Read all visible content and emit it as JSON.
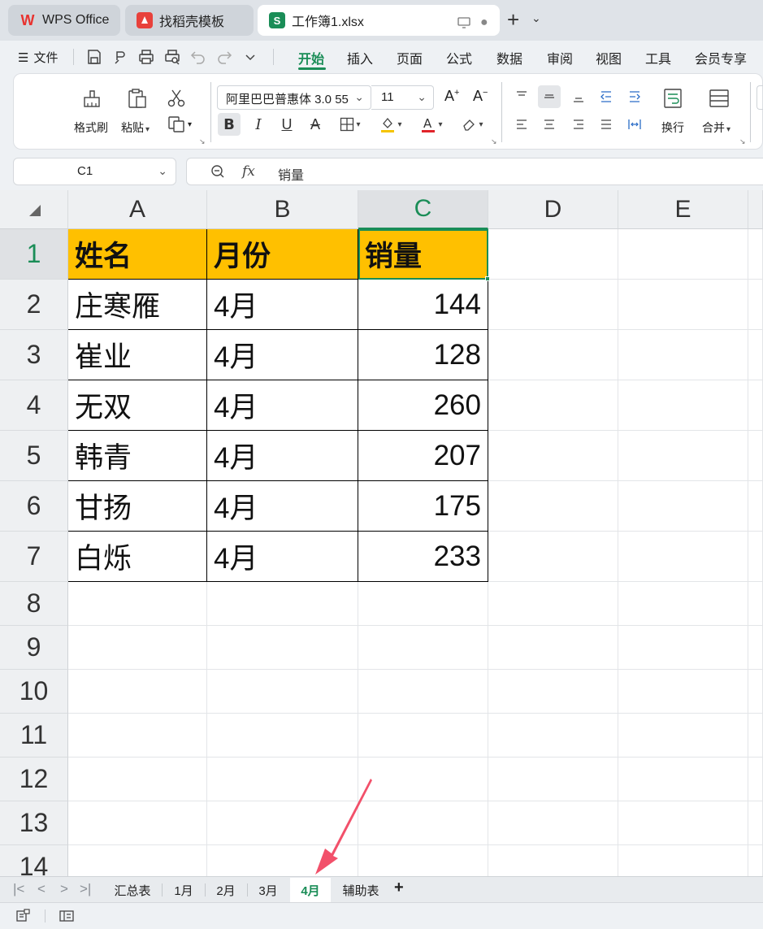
{
  "tabs": [
    {
      "label": "WPS Office",
      "icon": "wps-logo-icon"
    },
    {
      "label": "找稻壳模板",
      "icon": "docer-icon"
    },
    {
      "label": "工作簿1.xlsx",
      "icon": "spreadsheet-icon"
    }
  ],
  "menu": {
    "file_label": "文件",
    "tabs": [
      "开始",
      "插入",
      "页面",
      "公式",
      "数据",
      "审阅",
      "视图",
      "工具",
      "会员专享"
    ]
  },
  "ribbon": {
    "format_painter": "格式刷",
    "paste": "粘贴",
    "font_name": "阿里巴巴普惠体 3.0 55",
    "font_size": "11",
    "wrap": "换行",
    "merge": "合并"
  },
  "formula_bar": {
    "cell_ref": "C1",
    "fx": "fx",
    "value": "销量"
  },
  "grid": {
    "columns": [
      "A",
      "B",
      "C",
      "D",
      "E"
    ],
    "rows": [
      "1",
      "2",
      "3",
      "4",
      "5",
      "6",
      "7",
      "8",
      "9",
      "10",
      "11",
      "12",
      "13",
      "14"
    ],
    "header": [
      "姓名",
      "月份",
      "销量"
    ],
    "data": [
      [
        "庄寒雁",
        "4月",
        "144"
      ],
      [
        "崔业",
        "4月",
        "128"
      ],
      [
        "无双",
        "4月",
        "260"
      ],
      [
        "韩青",
        "4月",
        "207"
      ],
      [
        "甘扬",
        "4月",
        "175"
      ],
      [
        "白烁",
        "4月",
        "233"
      ]
    ]
  },
  "sheets": [
    "汇总表",
    "1月",
    "2月",
    "3月",
    "4月",
    "辅助表"
  ],
  "active_sheet": "4月",
  "colors": {
    "accent": "#1a8d57",
    "header_fill": "#ffc000",
    "arrow": "#f2506a"
  }
}
